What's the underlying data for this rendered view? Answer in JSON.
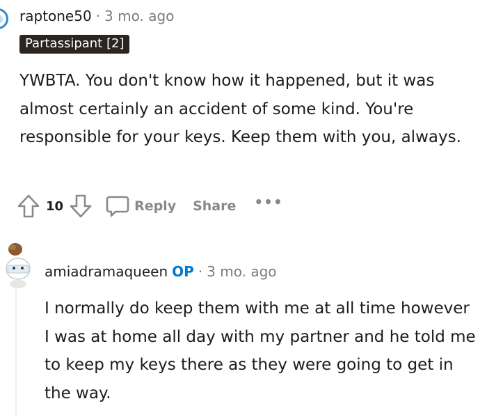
{
  "comment1": {
    "username": "raptone50",
    "separator": "·",
    "time": "3 mo. ago",
    "flair": "Partassipant [2]",
    "body": "YWBTA. You don't know how it happened, but it was almost certainly an accident of some kind. You're responsible for your keys. Keep them with you, always.",
    "score": "10",
    "reply_label": "Reply",
    "share_label": "Share",
    "more_label": "•••"
  },
  "comment2": {
    "username": "amiadramaqueen",
    "op_badge": "OP",
    "separator": "·",
    "time": "3 mo. ago",
    "body": "I normally do keep them with me at all time however I was at home all day with my partner and he told me to keep my keys there as they were going to get in the way."
  },
  "colors": {
    "flair_bg": "#2b2521",
    "op_blue": "#0079d3",
    "meta_gray": "#787c7e",
    "action_gray": "#878a8c"
  },
  "icons": [
    "user-avatar-icon",
    "upvote-arrow-icon",
    "downvote-arrow-icon",
    "comment-bubble-icon",
    "snoo-avatar-icon"
  ]
}
